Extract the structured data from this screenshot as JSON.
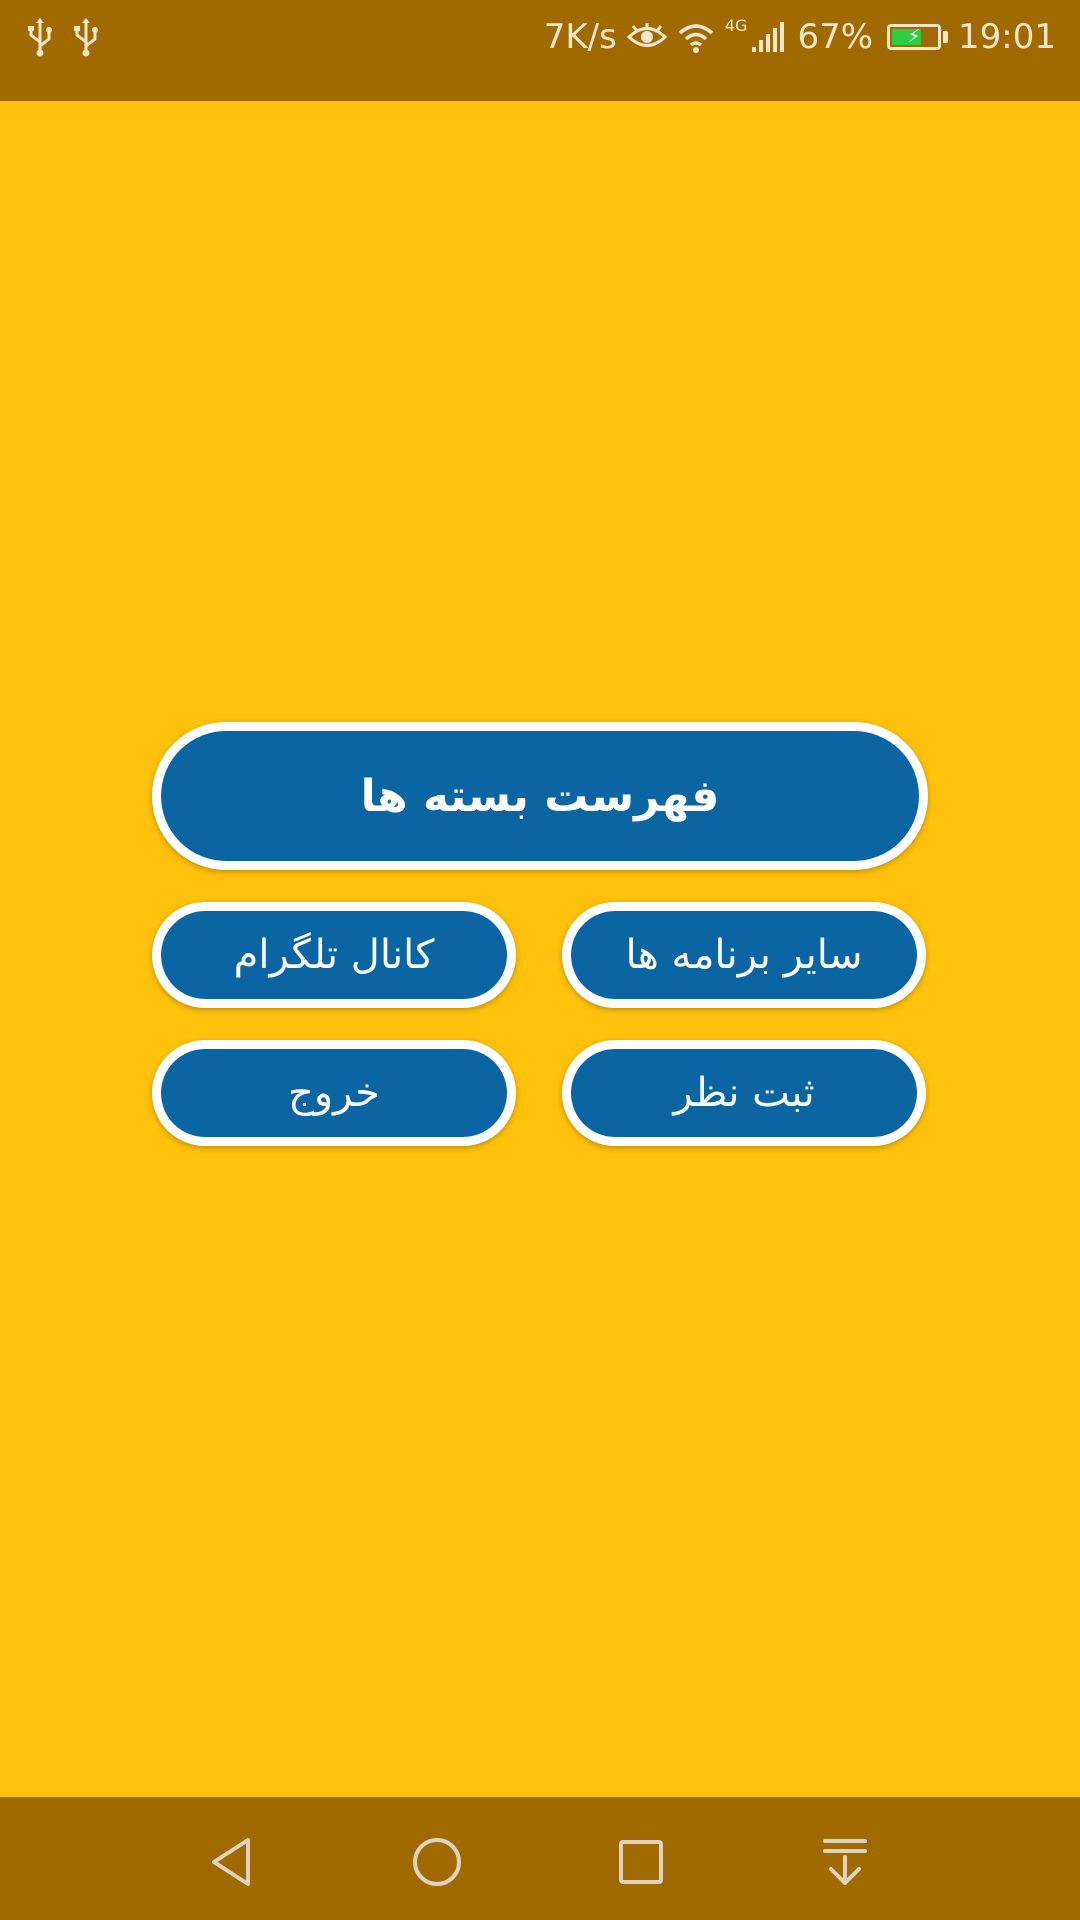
{
  "status_bar": {
    "left_icons": [
      "usb-icon",
      "usb-icon"
    ],
    "net_speed": "7K/s",
    "network_type": "4G",
    "battery_percent": "67%",
    "battery_level": 0.67,
    "battery_charging": true,
    "time": "19:01"
  },
  "menu": {
    "main_button": "فهرست بسته ها",
    "other_apps_button": "سایر برنامه ها",
    "telegram_button": "کانال تلگرام",
    "review_button": "ثبت نظر",
    "exit_button": "خروج"
  },
  "nav_bar": {
    "icons": [
      "back-icon",
      "home-icon",
      "recents-icon",
      "notification-pull-icon"
    ]
  },
  "colors": {
    "background": "#FFC10B",
    "system_bars": "#A06A00",
    "button_fill": "#0A65A2",
    "button_border": "#FFFFFF",
    "battery_fill": "#2ECC40"
  }
}
